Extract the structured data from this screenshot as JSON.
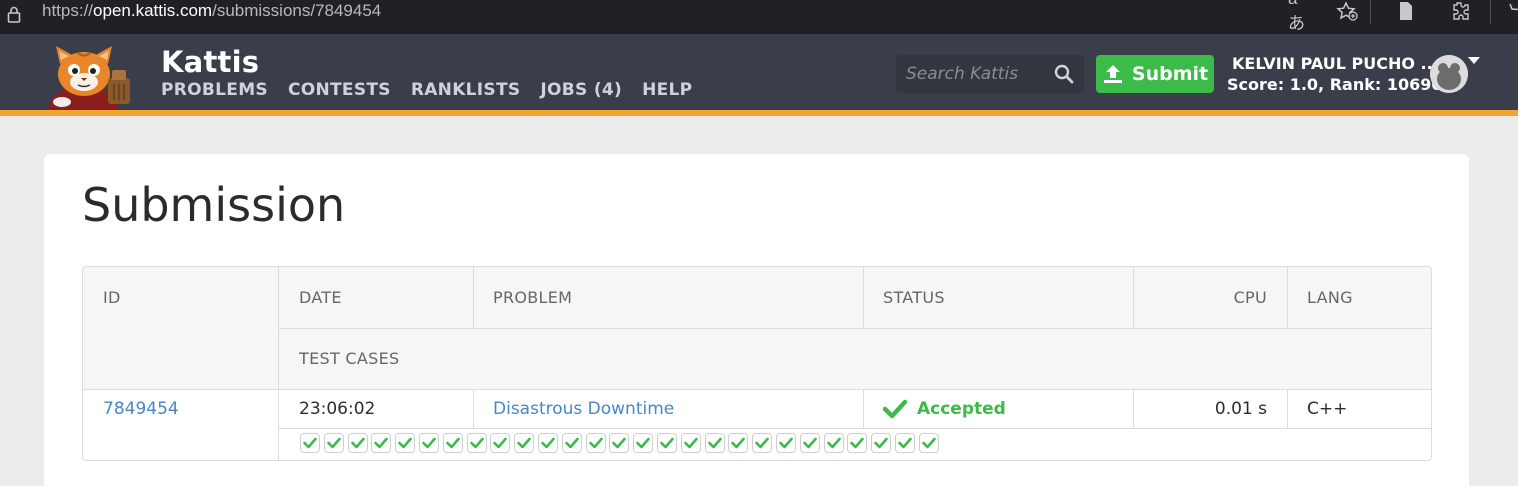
{
  "browser": {
    "url_scheme": "https://",
    "url_host": "open.kattis.com",
    "url_path": "/submissions/7849454",
    "reader_glyph": "aあ"
  },
  "nav": {
    "brand": "Kattis",
    "links": [
      "PROBLEMS",
      "CONTESTS",
      "RANKLISTS",
      "JOBS (4)",
      "HELP"
    ],
    "search_placeholder": "Search Kattis",
    "submit_label": "Submit",
    "user_name": "KELVIN PAUL PUCHO ...",
    "user_score": "Score: 1.0, Rank: 106905",
    "accent_color": "#f1a630",
    "submit_color": "#3cba4a"
  },
  "page": {
    "title": "Submission"
  },
  "table": {
    "headers": {
      "id": "ID",
      "date": "DATE",
      "problem": "PROBLEM",
      "status": "STATUS",
      "cpu": "CPU",
      "lang": "LANG",
      "test_cases": "TEST CASES"
    },
    "row": {
      "id": "7849454",
      "date": "23:06:02",
      "problem": "Disastrous Downtime",
      "status": "Accepted",
      "cpu": "0.01 s",
      "lang": "C++"
    },
    "test_case_count": 27,
    "test_case_status": "passed",
    "status_color": "#3cba4a"
  }
}
